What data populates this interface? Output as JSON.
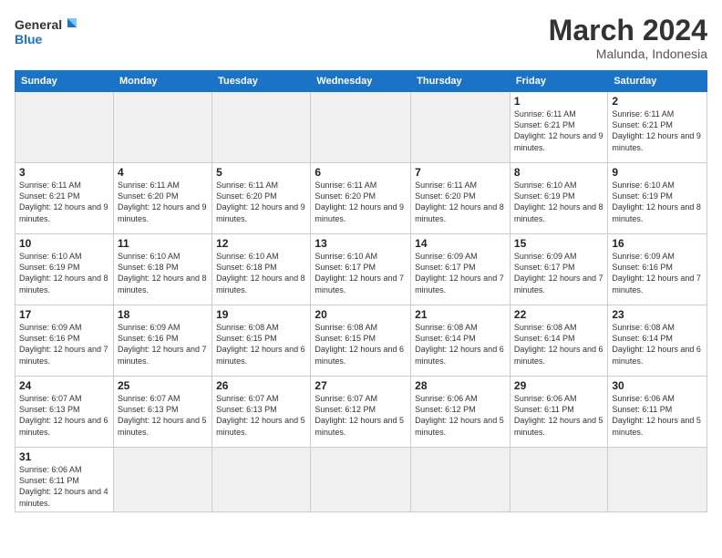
{
  "header": {
    "logo_general": "General",
    "logo_blue": "Blue",
    "month_title": "March 2024",
    "location": "Malunda, Indonesia"
  },
  "days_of_week": [
    "Sunday",
    "Monday",
    "Tuesday",
    "Wednesday",
    "Thursday",
    "Friday",
    "Saturday"
  ],
  "weeks": [
    [
      {
        "day": "",
        "info": ""
      },
      {
        "day": "",
        "info": ""
      },
      {
        "day": "",
        "info": ""
      },
      {
        "day": "",
        "info": ""
      },
      {
        "day": "",
        "info": ""
      },
      {
        "day": "1",
        "info": "Sunrise: 6:11 AM\nSunset: 6:21 PM\nDaylight: 12 hours\nand 9 minutes."
      },
      {
        "day": "2",
        "info": "Sunrise: 6:11 AM\nSunset: 6:21 PM\nDaylight: 12 hours\nand 9 minutes."
      }
    ],
    [
      {
        "day": "3",
        "info": "Sunrise: 6:11 AM\nSunset: 6:21 PM\nDaylight: 12 hours\nand 9 minutes."
      },
      {
        "day": "4",
        "info": "Sunrise: 6:11 AM\nSunset: 6:20 PM\nDaylight: 12 hours\nand 9 minutes."
      },
      {
        "day": "5",
        "info": "Sunrise: 6:11 AM\nSunset: 6:20 PM\nDaylight: 12 hours\nand 9 minutes."
      },
      {
        "day": "6",
        "info": "Sunrise: 6:11 AM\nSunset: 6:20 PM\nDaylight: 12 hours\nand 9 minutes."
      },
      {
        "day": "7",
        "info": "Sunrise: 6:11 AM\nSunset: 6:20 PM\nDaylight: 12 hours\nand 8 minutes."
      },
      {
        "day": "8",
        "info": "Sunrise: 6:10 AM\nSunset: 6:19 PM\nDaylight: 12 hours\nand 8 minutes."
      },
      {
        "day": "9",
        "info": "Sunrise: 6:10 AM\nSunset: 6:19 PM\nDaylight: 12 hours\nand 8 minutes."
      }
    ],
    [
      {
        "day": "10",
        "info": "Sunrise: 6:10 AM\nSunset: 6:19 PM\nDaylight: 12 hours\nand 8 minutes."
      },
      {
        "day": "11",
        "info": "Sunrise: 6:10 AM\nSunset: 6:18 PM\nDaylight: 12 hours\nand 8 minutes."
      },
      {
        "day": "12",
        "info": "Sunrise: 6:10 AM\nSunset: 6:18 PM\nDaylight: 12 hours\nand 8 minutes."
      },
      {
        "day": "13",
        "info": "Sunrise: 6:10 AM\nSunset: 6:17 PM\nDaylight: 12 hours\nand 7 minutes."
      },
      {
        "day": "14",
        "info": "Sunrise: 6:09 AM\nSunset: 6:17 PM\nDaylight: 12 hours\nand 7 minutes."
      },
      {
        "day": "15",
        "info": "Sunrise: 6:09 AM\nSunset: 6:17 PM\nDaylight: 12 hours\nand 7 minutes."
      },
      {
        "day": "16",
        "info": "Sunrise: 6:09 AM\nSunset: 6:16 PM\nDaylight: 12 hours\nand 7 minutes."
      }
    ],
    [
      {
        "day": "17",
        "info": "Sunrise: 6:09 AM\nSunset: 6:16 PM\nDaylight: 12 hours\nand 7 minutes."
      },
      {
        "day": "18",
        "info": "Sunrise: 6:09 AM\nSunset: 6:16 PM\nDaylight: 12 hours\nand 7 minutes."
      },
      {
        "day": "19",
        "info": "Sunrise: 6:08 AM\nSunset: 6:15 PM\nDaylight: 12 hours\nand 6 minutes."
      },
      {
        "day": "20",
        "info": "Sunrise: 6:08 AM\nSunset: 6:15 PM\nDaylight: 12 hours\nand 6 minutes."
      },
      {
        "day": "21",
        "info": "Sunrise: 6:08 AM\nSunset: 6:14 PM\nDaylight: 12 hours\nand 6 minutes."
      },
      {
        "day": "22",
        "info": "Sunrise: 6:08 AM\nSunset: 6:14 PM\nDaylight: 12 hours\nand 6 minutes."
      },
      {
        "day": "23",
        "info": "Sunrise: 6:08 AM\nSunset: 6:14 PM\nDaylight: 12 hours\nand 6 minutes."
      }
    ],
    [
      {
        "day": "24",
        "info": "Sunrise: 6:07 AM\nSunset: 6:13 PM\nDaylight: 12 hours\nand 6 minutes."
      },
      {
        "day": "25",
        "info": "Sunrise: 6:07 AM\nSunset: 6:13 PM\nDaylight: 12 hours\nand 5 minutes."
      },
      {
        "day": "26",
        "info": "Sunrise: 6:07 AM\nSunset: 6:13 PM\nDaylight: 12 hours\nand 5 minutes."
      },
      {
        "day": "27",
        "info": "Sunrise: 6:07 AM\nSunset: 6:12 PM\nDaylight: 12 hours\nand 5 minutes."
      },
      {
        "day": "28",
        "info": "Sunrise: 6:06 AM\nSunset: 6:12 PM\nDaylight: 12 hours\nand 5 minutes."
      },
      {
        "day": "29",
        "info": "Sunrise: 6:06 AM\nSunset: 6:11 PM\nDaylight: 12 hours\nand 5 minutes."
      },
      {
        "day": "30",
        "info": "Sunrise: 6:06 AM\nSunset: 6:11 PM\nDaylight: 12 hours\nand 5 minutes."
      }
    ],
    [
      {
        "day": "31",
        "info": "Sunrise: 6:06 AM\nSunset: 6:11 PM\nDaylight: 12 hours\nand 4 minutes."
      },
      {
        "day": "",
        "info": ""
      },
      {
        "day": "",
        "info": ""
      },
      {
        "day": "",
        "info": ""
      },
      {
        "day": "",
        "info": ""
      },
      {
        "day": "",
        "info": ""
      },
      {
        "day": "",
        "info": ""
      }
    ]
  ]
}
